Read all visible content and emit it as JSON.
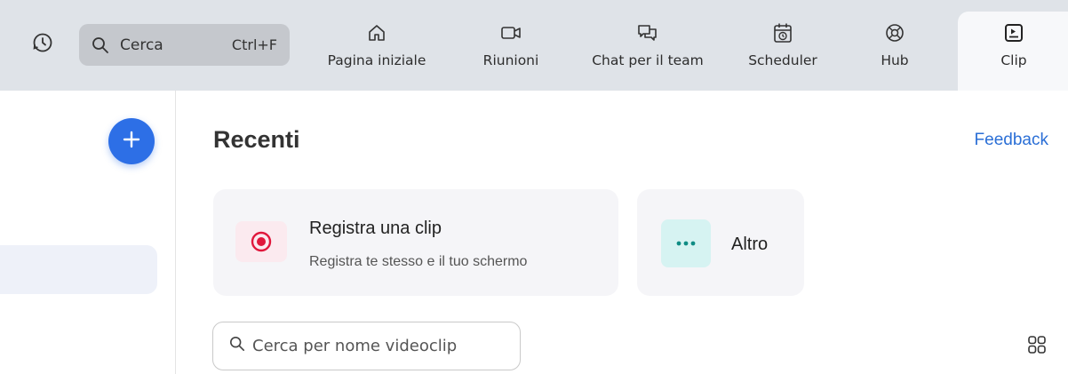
{
  "topbar": {
    "history_icon": "history-icon",
    "search": {
      "label": "Cerca",
      "shortcut": "Ctrl+F",
      "icon": "search-icon"
    },
    "nav": [
      {
        "label": "Pagina iniziale",
        "icon": "home-icon"
      },
      {
        "label": "Riunioni",
        "icon": "video-icon"
      },
      {
        "label": "Chat per il team",
        "icon": "chat-icon"
      },
      {
        "label": "Scheduler",
        "icon": "calendar-clock-icon"
      },
      {
        "label": "Hub",
        "icon": "hub-icon"
      },
      {
        "label": "Clip",
        "icon": "clip-icon",
        "active": true
      }
    ]
  },
  "sidebar": {
    "new_icon": "plus-icon"
  },
  "main": {
    "title": "Recenti",
    "feedback": "Feedback",
    "cards": {
      "record": {
        "title": "Registra una clip",
        "subtitle": "Registra te stesso e il tuo schermo",
        "icon": "record-icon"
      },
      "more": {
        "title": "Altro",
        "icon": "more-icon"
      }
    },
    "search_placeholder": "Cerca per nome videoclip",
    "grid_icon": "grid-view-icon"
  },
  "colors": {
    "accent": "#2d6fe6",
    "link": "#2b6fd6",
    "record": "#e0183c",
    "more": "#0f8c84"
  }
}
